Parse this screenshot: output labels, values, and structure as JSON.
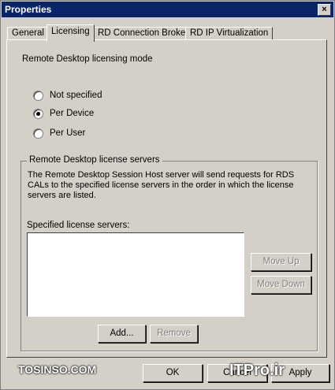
{
  "window": {
    "title": "Properties",
    "close_symbol": "×"
  },
  "tabs": [
    {
      "label": "General",
      "active": false
    },
    {
      "label": "Licensing",
      "active": true
    },
    {
      "label": "RD Connection Broker",
      "active": false
    },
    {
      "label": "RD IP Virtualization",
      "active": false
    }
  ],
  "licensing": {
    "mode_label": "Remote Desktop licensing mode",
    "options": [
      {
        "label": "Not specified",
        "selected": false
      },
      {
        "label": "Per Device",
        "selected": true
      },
      {
        "label": "Per User",
        "selected": false
      }
    ],
    "servers_group": {
      "title": "Remote Desktop license servers",
      "description": "The Remote Desktop Session Host server will send requests for RDS CALs to the specified license servers in the order in which the license servers are listed.",
      "list_label": "Specified license servers:",
      "list_items": []
    },
    "buttons": {
      "move_up": "Move Up",
      "move_down": "Move Down",
      "add": "Add...",
      "remove": "Remove"
    }
  },
  "footer": {
    "ok": "OK",
    "cancel": "Cancel",
    "apply": "Apply"
  },
  "watermark": {
    "left": "TOSINSO.COM",
    "right": "ITPro.ir"
  }
}
